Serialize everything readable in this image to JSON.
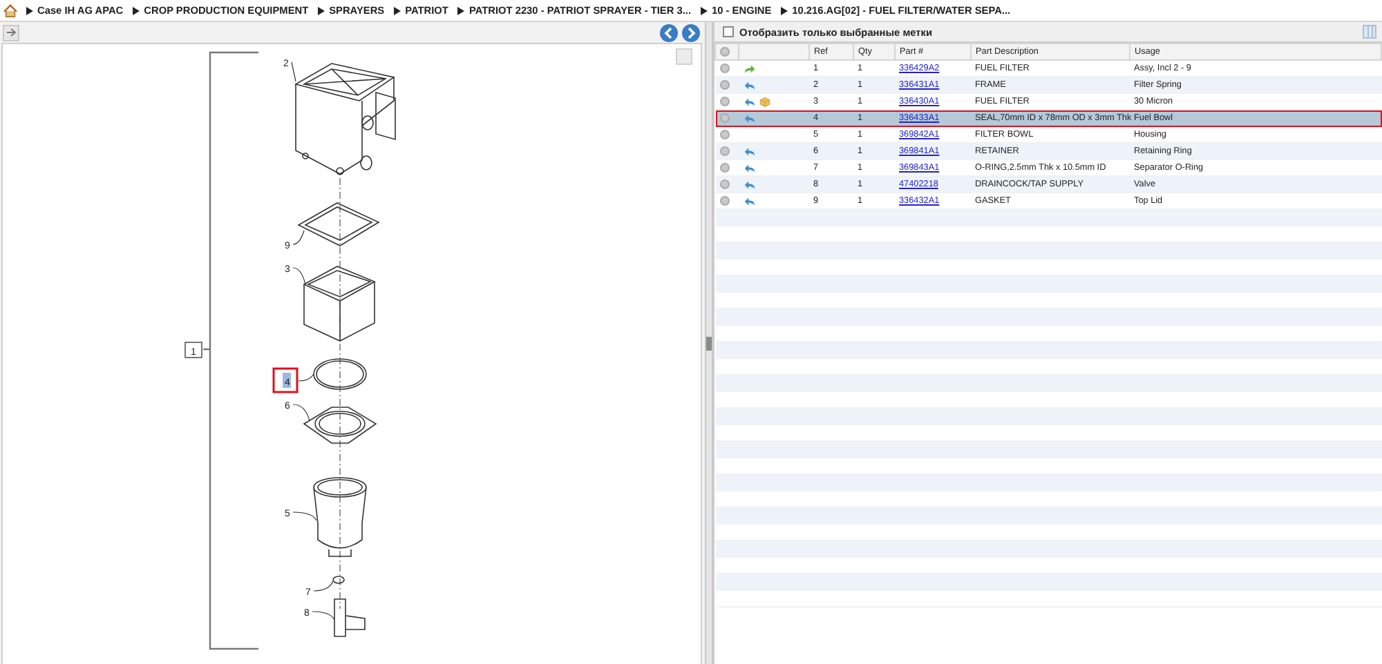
{
  "breadcrumb": [
    {
      "label": "Case IH AG APAC"
    },
    {
      "label": "CROP PRODUCTION EQUIPMENT"
    },
    {
      "label": "SPRAYERS"
    },
    {
      "label": "PATRIOT"
    },
    {
      "label": "PATRIOT 2230 - PATRIOT SPRAYER - TIER 3..."
    },
    {
      "label": "10 - ENGINE"
    },
    {
      "label": "10.216.AG[02] - FUEL FILTER/WATER SEPA..."
    }
  ],
  "diagram": {
    "callouts": [
      {
        "label": "1",
        "kind": "boxed",
        "selected": false
      },
      {
        "label": "2",
        "kind": "plain",
        "selected": false
      },
      {
        "label": "9",
        "kind": "plain",
        "selected": false
      },
      {
        "label": "3",
        "kind": "plain",
        "selected": false
      },
      {
        "label": "4",
        "kind": "plain",
        "selected": true
      },
      {
        "label": "6",
        "kind": "plain",
        "selected": false
      },
      {
        "label": "5",
        "kind": "plain",
        "selected": false
      },
      {
        "label": "7",
        "kind": "plain",
        "selected": false
      },
      {
        "label": "8",
        "kind": "plain",
        "selected": false
      }
    ]
  },
  "filter": {
    "label": "Отобразить только выбранные метки",
    "checked": false
  },
  "table": {
    "columns": [
      "Ref",
      "Qty",
      "Part #",
      "Part Description",
      "Usage"
    ],
    "rows": [
      {
        "ref": "1",
        "qty": "1",
        "part": "336429A2",
        "description": "FUEL FILTER",
        "usage": "Assy, Incl 2 - 9",
        "kind": "assembly",
        "note": false,
        "selected": false
      },
      {
        "ref": "2",
        "qty": "1",
        "part": "336431A1",
        "description": "FRAME",
        "usage": "Filter Spring",
        "kind": "component",
        "note": false,
        "selected": false
      },
      {
        "ref": "3",
        "qty": "1",
        "part": "336430A1",
        "description": "FUEL FILTER",
        "usage": "30 Micron",
        "kind": "component",
        "note": true,
        "selected": false
      },
      {
        "ref": "4",
        "qty": "1",
        "part": "336433A1",
        "description": "SEAL,70mm ID x 78mm OD x 3mm Thk",
        "usage": "Fuel Bowl",
        "kind": "component",
        "note": false,
        "selected": true
      },
      {
        "ref": "5",
        "qty": "1",
        "part": "369842A1",
        "description": "FILTER BOWL",
        "usage": "Housing",
        "kind": "plain",
        "note": false,
        "selected": false
      },
      {
        "ref": "6",
        "qty": "1",
        "part": "369841A1",
        "description": "RETAINER",
        "usage": "Retaining Ring",
        "kind": "component",
        "note": false,
        "selected": false
      },
      {
        "ref": "7",
        "qty": "1",
        "part": "369843A1",
        "description": "O-RING,2.5mm Thk x 10.5mm ID",
        "usage": "Separator O-Ring",
        "kind": "component",
        "note": false,
        "selected": false
      },
      {
        "ref": "8",
        "qty": "1",
        "part": "47402218",
        "description": "DRAINCOCK/TAP SUPPLY",
        "usage": "Valve",
        "kind": "component",
        "note": false,
        "selected": false
      },
      {
        "ref": "9",
        "qty": "1",
        "part": "336432A1",
        "description": "GASKET",
        "usage": "Top Lid",
        "kind": "component",
        "note": false,
        "selected": false
      }
    ]
  }
}
